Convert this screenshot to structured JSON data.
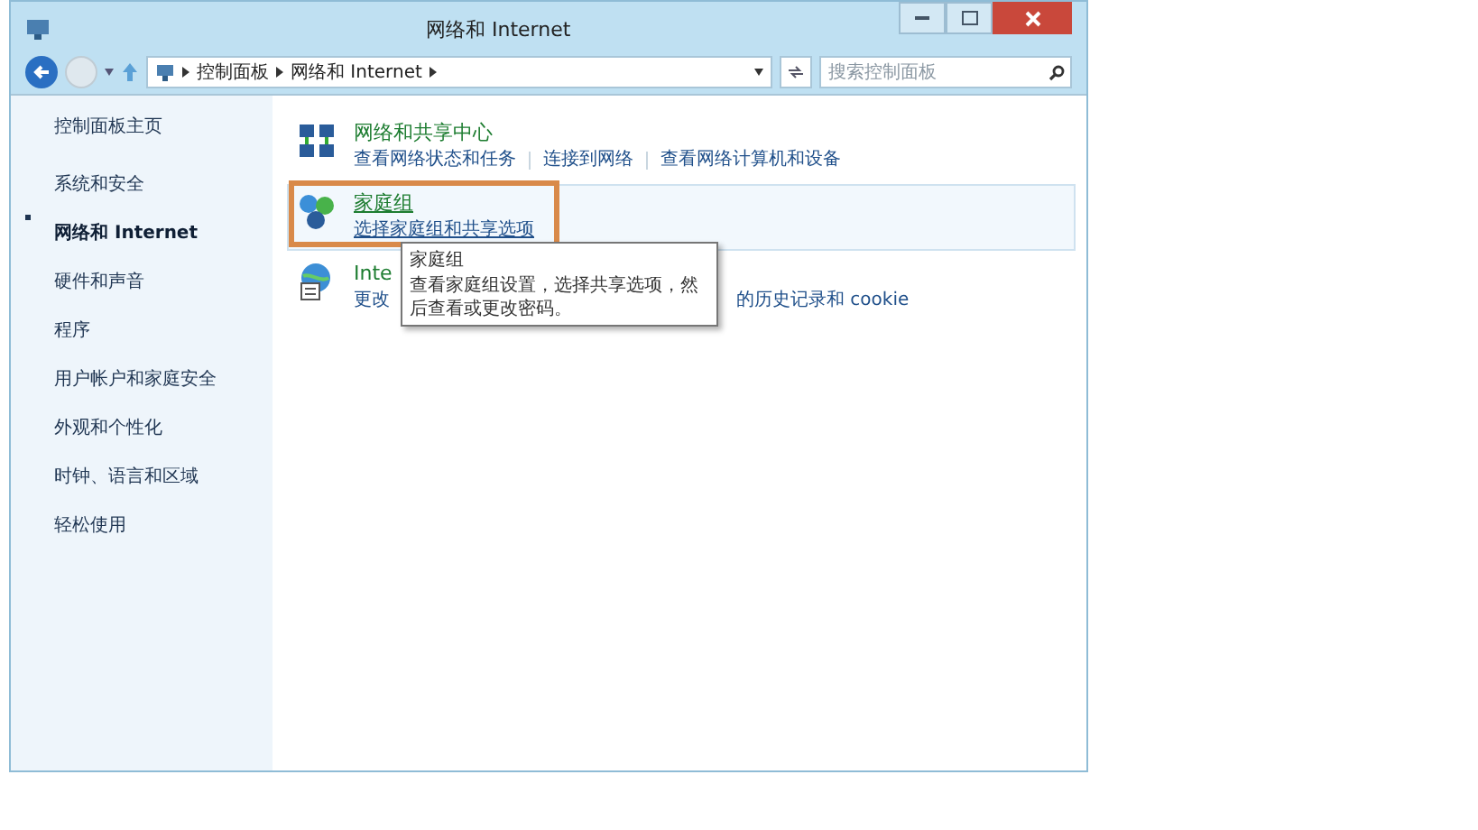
{
  "window": {
    "title": "网络和 Internet"
  },
  "address_bar": {
    "path": [
      "控制面板",
      "网络和 Internet"
    ]
  },
  "search": {
    "placeholder": "搜索控制面板"
  },
  "sidebar": {
    "home": "控制面板主页",
    "items": [
      {
        "label": "系统和安全",
        "selected": false
      },
      {
        "label": "网络和 Internet",
        "selected": true
      },
      {
        "label": "硬件和声音",
        "selected": false
      },
      {
        "label": "程序",
        "selected": false
      },
      {
        "label": "用户帐户和家庭安全",
        "selected": false
      },
      {
        "label": "外观和个性化",
        "selected": false
      },
      {
        "label": "时钟、语言和区域",
        "selected": false
      },
      {
        "label": "轻松使用",
        "selected": false
      }
    ]
  },
  "categories": [
    {
      "title": "网络和共享中心",
      "links": [
        "查看网络状态和任务",
        "连接到网络",
        "查看网络计算机和设备"
      ],
      "highlighted": false,
      "marked": false,
      "covered_by_tooltip": false
    },
    {
      "title": "家庭组",
      "links": [
        "选择家庭组和共享选项"
      ],
      "highlighted": true,
      "marked": true,
      "covered_by_tooltip": false
    },
    {
      "title": "Inte",
      "links": [
        "更改",
        "的历史记录和 cookie"
      ],
      "highlighted": false,
      "marked": false,
      "covered_by_tooltip": true
    }
  ],
  "tooltip": {
    "title": "家庭组",
    "text": "查看家庭组设置，选择共享选项，然后查看或更改密码。"
  }
}
